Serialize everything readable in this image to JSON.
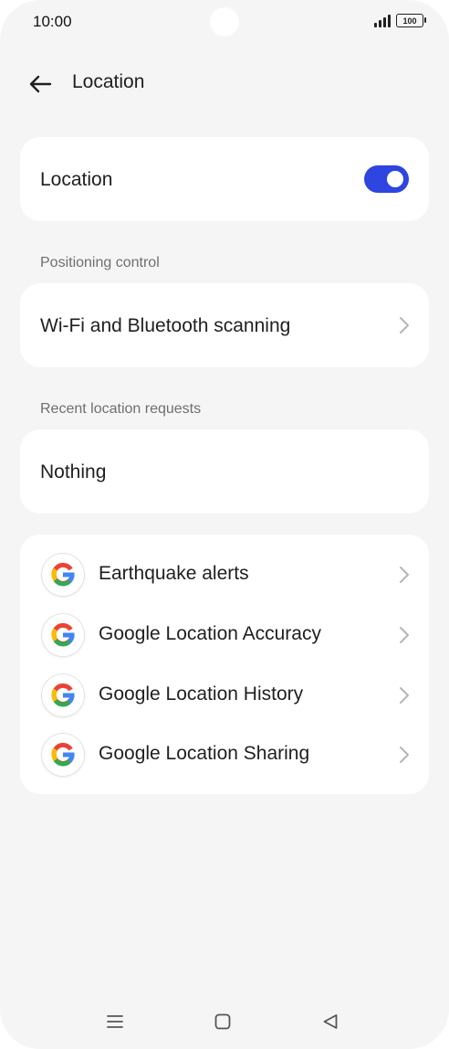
{
  "status_bar": {
    "time": "10:00",
    "battery": "100",
    "icons": [
      "signal-icon",
      "battery-icon"
    ]
  },
  "header": {
    "back_icon": "arrow-left-icon",
    "title": "Location"
  },
  "location_toggle": {
    "label": "Location",
    "state": "on",
    "accent": "#2f45e0"
  },
  "positioning": {
    "section_label": "Positioning control",
    "item_label": "Wi-Fi and Bluetooth scanning"
  },
  "recent": {
    "section_label": "Recent location requests",
    "item_label": "Nothing"
  },
  "google_services": [
    {
      "label": "Earthquake alerts",
      "icon": "google-icon"
    },
    {
      "label": "Google Location Accuracy",
      "icon": "google-icon"
    },
    {
      "label": "Google Location History",
      "icon": "google-icon"
    },
    {
      "label": "Google Location Sharing",
      "icon": "google-icon"
    }
  ],
  "nav_bar": {
    "icons": [
      "menu-icon",
      "home-icon",
      "back-triangle-icon"
    ]
  }
}
